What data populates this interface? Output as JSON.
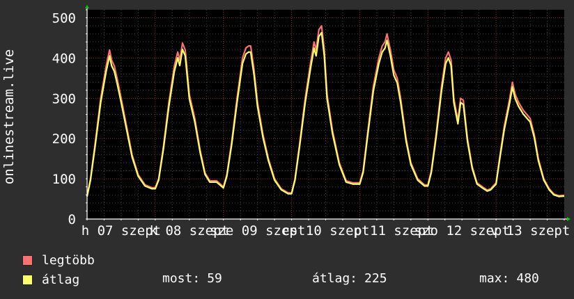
{
  "chart_data": {
    "type": "line",
    "ylabel": "onlinestream.live",
    "ylim": [
      0,
      520
    ],
    "y_ticks": [
      0,
      100,
      200,
      300,
      400,
      500
    ],
    "x_ticks": [
      "h 07 szept",
      "k 08 szept",
      "sze 09 szept",
      "cs 10 szept",
      "p 11 szept",
      "szo 12 szept",
      "v 13 szept"
    ],
    "grid": true,
    "series": [
      {
        "name": "legtöbb",
        "color": "#ff7070"
      },
      {
        "name": "átlag",
        "color": "#ffff66"
      }
    ],
    "points": [
      [
        0.0,
        58
      ],
      [
        0.05,
        100
      ],
      [
        0.12,
        190
      ],
      [
        0.2,
        300
      ],
      [
        0.28,
        380
      ],
      [
        0.33,
        420
      ],
      [
        0.36,
        395
      ],
      [
        0.4,
        380
      ],
      [
        0.44,
        350
      ],
      [
        0.5,
        300
      ],
      [
        0.58,
        230
      ],
      [
        0.66,
        160
      ],
      [
        0.75,
        110
      ],
      [
        0.85,
        85
      ],
      [
        0.95,
        78
      ],
      [
        1.0,
        78
      ],
      [
        1.05,
        100
      ],
      [
        1.12,
        180
      ],
      [
        1.2,
        290
      ],
      [
        1.28,
        380
      ],
      [
        1.33,
        415
      ],
      [
        1.36,
        395
      ],
      [
        1.4,
        437
      ],
      [
        1.44,
        420
      ],
      [
        1.5,
        310
      ],
      [
        1.58,
        250
      ],
      [
        1.66,
        170
      ],
      [
        1.73,
        115
      ],
      [
        1.8,
        95
      ],
      [
        1.9,
        95
      ],
      [
        2.0,
        80
      ],
      [
        2.05,
        110
      ],
      [
        2.12,
        190
      ],
      [
        2.2,
        300
      ],
      [
        2.28,
        400
      ],
      [
        2.33,
        425
      ],
      [
        2.37,
        430
      ],
      [
        2.4,
        430
      ],
      [
        2.45,
        370
      ],
      [
        2.5,
        290
      ],
      [
        2.58,
        210
      ],
      [
        2.66,
        150
      ],
      [
        2.75,
        100
      ],
      [
        2.85,
        75
      ],
      [
        2.95,
        65
      ],
      [
        3.0,
        65
      ],
      [
        3.05,
        100
      ],
      [
        3.12,
        190
      ],
      [
        3.2,
        300
      ],
      [
        3.28,
        390
      ],
      [
        3.33,
        440
      ],
      [
        3.36,
        420
      ],
      [
        3.4,
        470
      ],
      [
        3.44,
        480
      ],
      [
        3.48,
        420
      ],
      [
        3.52,
        310
      ],
      [
        3.6,
        220
      ],
      [
        3.7,
        140
      ],
      [
        3.8,
        95
      ],
      [
        3.9,
        90
      ],
      [
        4.0,
        90
      ],
      [
        4.05,
        120
      ],
      [
        4.12,
        220
      ],
      [
        4.2,
        330
      ],
      [
        4.28,
        400
      ],
      [
        4.33,
        430
      ],
      [
        4.37,
        440
      ],
      [
        4.4,
        460
      ],
      [
        4.45,
        420
      ],
      [
        4.5,
        370
      ],
      [
        4.55,
        350
      ],
      [
        4.6,
        300
      ],
      [
        4.68,
        200
      ],
      [
        4.75,
        140
      ],
      [
        4.85,
        100
      ],
      [
        4.95,
        85
      ],
      [
        5.0,
        85
      ],
      [
        5.05,
        120
      ],
      [
        5.12,
        210
      ],
      [
        5.2,
        330
      ],
      [
        5.26,
        400
      ],
      [
        5.3,
        415
      ],
      [
        5.34,
        395
      ],
      [
        5.38,
        300
      ],
      [
        5.44,
        245
      ],
      [
        5.48,
        300
      ],
      [
        5.52,
        295
      ],
      [
        5.58,
        200
      ],
      [
        5.65,
        130
      ],
      [
        5.72,
        90
      ],
      [
        5.8,
        80
      ],
      [
        5.87,
        72
      ],
      [
        5.92,
        75
      ],
      [
        6.0,
        90
      ],
      [
        6.05,
        150
      ],
      [
        6.12,
        230
      ],
      [
        6.2,
        300
      ],
      [
        6.24,
        340
      ],
      [
        6.28,
        310
      ],
      [
        6.33,
        290
      ],
      [
        6.4,
        270
      ],
      [
        6.45,
        260
      ],
      [
        6.5,
        250
      ],
      [
        6.56,
        210
      ],
      [
        6.62,
        150
      ],
      [
        6.7,
        100
      ],
      [
        6.78,
        75
      ],
      [
        6.85,
        62
      ],
      [
        6.92,
        58
      ],
      [
        7.0,
        59
      ]
    ],
    "stats": {
      "most_label": "most:",
      "most": 59,
      "avg_label": "átlag:",
      "avg": 225,
      "max_label": "max:",
      "max": 480
    }
  },
  "colors": {
    "background": "#2e2e2e",
    "plot": "#000000",
    "grid_major": "#8a3030",
    "grid_minor": "#444444",
    "axis": "#ffffff",
    "arrow": "#00cc00"
  }
}
